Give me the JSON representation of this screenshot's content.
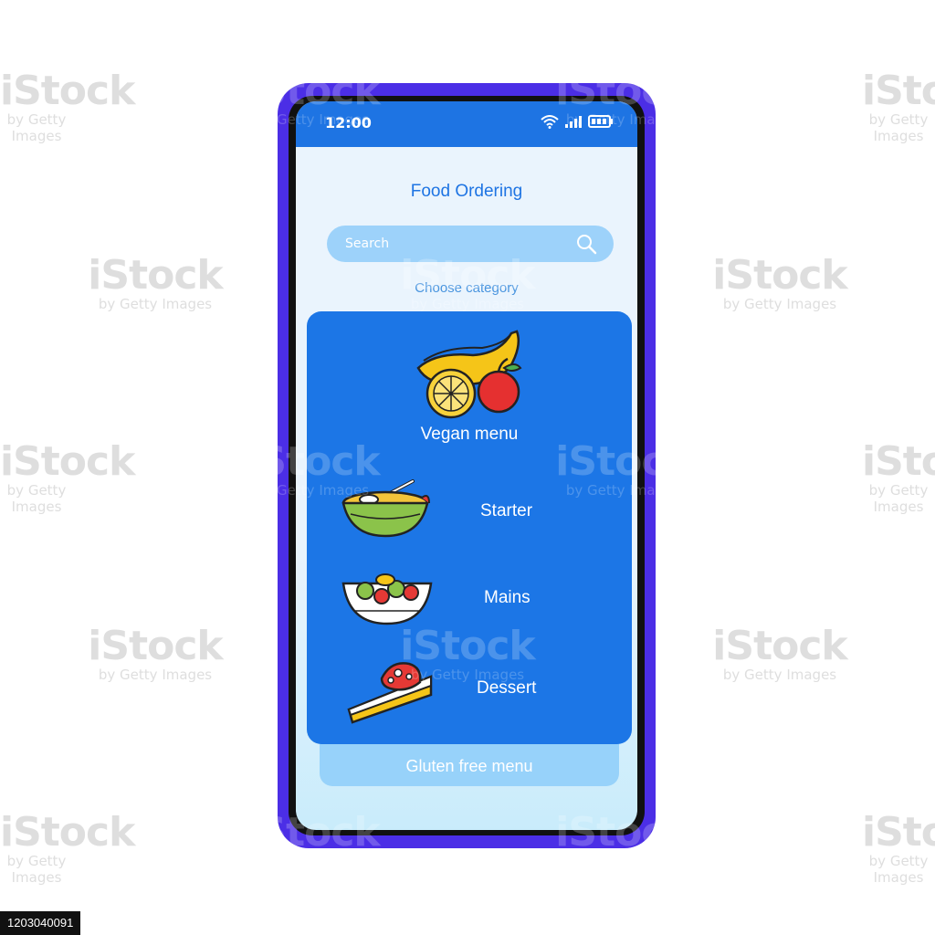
{
  "status": {
    "time": "12:00"
  },
  "app": {
    "title": "Food Ordering"
  },
  "search": {
    "placeholder": "Search"
  },
  "category_prompt": "Choose category",
  "categories": [
    {
      "label": "Vegan menu",
      "icon": "fruits-icon"
    },
    {
      "label": "Starter",
      "icon": "soup-bowl-icon"
    },
    {
      "label": "Mains",
      "icon": "salad-bowl-icon"
    },
    {
      "label": "Dessert",
      "icon": "cake-slice-icon"
    }
  ],
  "secondary_category": "Gluten free menu",
  "watermark": {
    "brand": "iStock",
    "credit": "by Getty Images",
    "id": "1203040091"
  },
  "colors": {
    "frame": "#4b2ee6",
    "accent": "#1e74e3",
    "card": "#1c76e6",
    "search_bg": "#9dd2fa"
  }
}
